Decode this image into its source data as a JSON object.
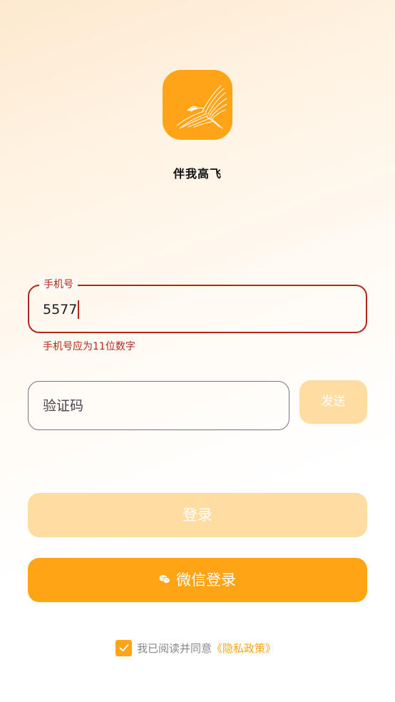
{
  "app": {
    "name": "伴我高飞",
    "logo_icon": "eagle-icon",
    "brand_color": "#ffa414"
  },
  "phone": {
    "label": "手机号",
    "value": "5577",
    "error": "手机号应为11位数字",
    "error_color": "#b3261e"
  },
  "code": {
    "placeholder": "验证码",
    "send_label": "发送"
  },
  "buttons": {
    "login_label": "登录",
    "wechat_label": "微信登录",
    "wechat_icon": "wechat-icon"
  },
  "agreement": {
    "checked": true,
    "text": "我已阅读并同意",
    "link": "《隐私政策》"
  }
}
